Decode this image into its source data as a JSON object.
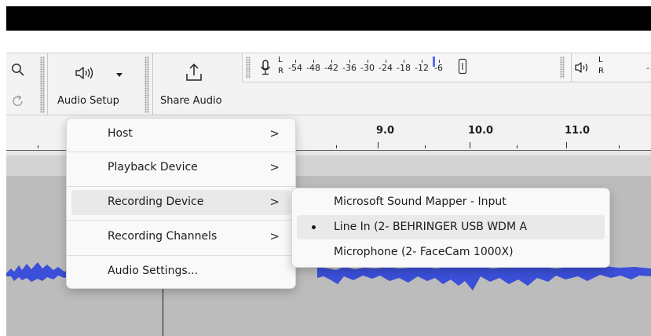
{
  "toolbar": {
    "audio_setup_label": "Audio Setup",
    "share_audio_label": "Share Audio",
    "meter_ticks": [
      "-54",
      "-48",
      "-42",
      "-36",
      "-30",
      "-24",
      "-18",
      "-12",
      "-6"
    ],
    "meter_left_label": "L",
    "meter_right_label": "R",
    "meter_partial_tick": "-"
  },
  "ruler": {
    "labels": [
      "9.0",
      "10.0",
      "11.0"
    ]
  },
  "audio_setup_menu": {
    "items": [
      {
        "label": "Host",
        "has_submenu": true
      },
      {
        "label": "Playback Device",
        "has_submenu": true
      },
      {
        "label": "Recording Device",
        "has_submenu": true,
        "hovered": true
      },
      {
        "label": "Recording Channels",
        "has_submenu": true
      },
      {
        "label": "Audio Settings...",
        "has_submenu": false
      }
    ],
    "submenu_arrow": ">"
  },
  "recording_device_submenu": {
    "items": [
      {
        "label": "Microsoft Sound Mapper - Input",
        "selected": false
      },
      {
        "label": "Line In (2- BEHRINGER USB WDM A",
        "selected": true
      },
      {
        "label": "Microphone (2- FaceCam 1000X)",
        "selected": false
      }
    ]
  },
  "colors": {
    "waveform": "#3b4fd8",
    "menu_bg": "#f9f9f9",
    "hover_bg": "#e9e9e9",
    "meter_marker": "#5a6cf0"
  }
}
